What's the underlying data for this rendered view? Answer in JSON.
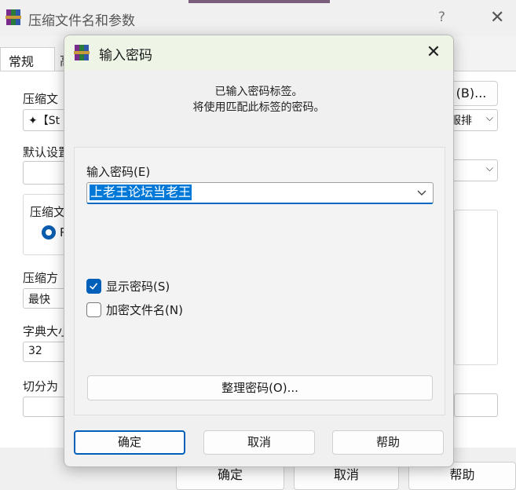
{
  "background": {
    "window_title": "压缩文件名和参数",
    "help_glyph": "?",
    "close_glyph": "✕",
    "tabs": [
      "常规",
      "高"
    ],
    "archive_name_label": "压缩文",
    "archive_name_value": "✦【St",
    "browse_button": "(B)...",
    "profile_select_value": "服排",
    "default_profile_label": "默认设置",
    "archive_format_label": "压缩文",
    "radio_label": "R",
    "method_label": "压缩方",
    "method_value": "最快",
    "dict_label": "字典大小",
    "dict_value": "32",
    "split_label": "切分为",
    "ok_button": "确定",
    "cancel_button": "取消",
    "help_button": "帮助"
  },
  "dialog": {
    "title": "输入密码",
    "close_glyph": "✕",
    "message_line1": "已输入密码标签。",
    "message_line2": "将使用匹配此标签的密码。",
    "password_label": "输入密码(E)",
    "password_value": "上老王论坛当老王",
    "show_password": {
      "label": "显示密码(S)",
      "checked": true
    },
    "encrypt_filenames": {
      "label": "加密文件名(N)",
      "checked": false
    },
    "organize_button": "整理密码(O)...",
    "ok_button": "确定",
    "cancel_button": "取消",
    "help_button": "帮助"
  },
  "colors": {
    "accent": "#005fb8",
    "selection": "#0078d7",
    "dialog_titlebar": "#eef5e6"
  }
}
